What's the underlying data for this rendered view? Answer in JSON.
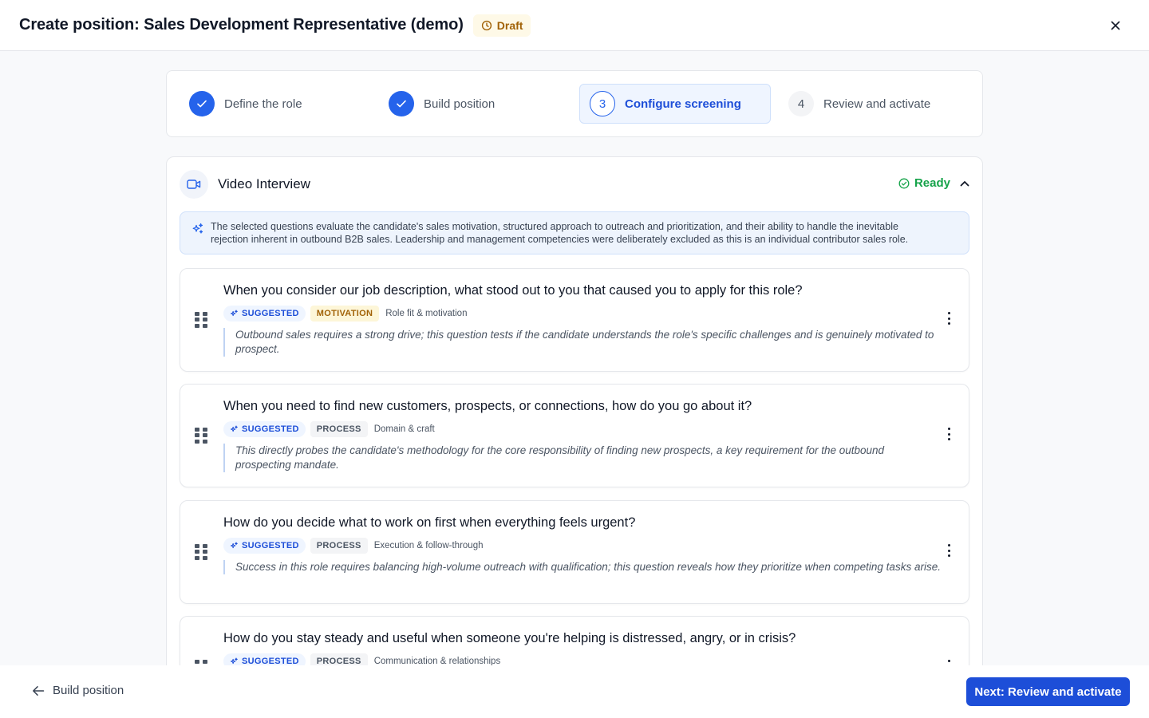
{
  "header": {
    "title": "Create position: Sales Development Representative (demo)",
    "status": "Draft"
  },
  "stepper": {
    "steps": [
      {
        "label": "Define the role",
        "state": "done",
        "number": "1"
      },
      {
        "label": "Build position",
        "state": "done",
        "number": "2"
      },
      {
        "label": "Configure screening",
        "state": "active",
        "number": "3"
      },
      {
        "label": "Review and activate",
        "state": "todo",
        "number": "4"
      }
    ]
  },
  "video_interview": {
    "title": "Video Interview",
    "status": "Ready",
    "summary_line1": "The selected questions evaluate the candidate's sales motivation, structured approach to outreach and prioritization, and their ability to handle the inevitable",
    "summary_line2": "rejection inherent in outbound B2B sales. Leadership and management competencies were deliberately excluded as this is an individual contributor sales role.",
    "questions": [
      {
        "text": "When you consider our job description, what stood out to you that caused you to apply for this role?",
        "suggested": "SUGGESTED",
        "type": "MOTIVATION",
        "category": "Role fit & motivation",
        "reason": "Outbound sales requires a strong drive; this question tests if the candidate understands the role's specific challenges and is genuinely motivated to prospect."
      },
      {
        "text": "When you need to find new customers, prospects, or connections, how do you go about it?",
        "suggested": "SUGGESTED",
        "type": "PROCESS",
        "category": "Domain & craft",
        "reason": "This directly probes the candidate's methodology for the core responsibility of finding new prospects, a key requirement for the outbound prospecting mandate."
      },
      {
        "text": "How do you decide what to work on first when everything feels urgent?",
        "suggested": "SUGGESTED",
        "type": "PROCESS",
        "category": "Execution & follow-through",
        "reason": "Success in this role requires balancing high-volume outreach with qualification; this question reveals how they prioritize when competing tasks arise."
      },
      {
        "text": "How do you stay steady and useful when someone you're helping is distressed, angry, or in crisis?",
        "suggested": "SUGGESTED",
        "type": "PROCESS",
        "category": "Communication & relationships",
        "reason": ""
      }
    ]
  },
  "footer": {
    "back_label": "Build position",
    "next_label": "Next: Review and activate"
  },
  "colors": {
    "primary": "#1d4ed8",
    "ready": "#16a34a",
    "draft_bg": "#fef9e7",
    "draft_text": "#a16207"
  },
  "icons": {
    "draft": "clock-icon",
    "close": "close-icon",
    "step_done": "check-icon",
    "video": "video-camera-icon",
    "ready": "check-circle-icon",
    "collapse": "chevron-up-icon",
    "ai": "sparkles-icon",
    "drag": "drag-handle-icon",
    "menu": "kebab-menu-icon",
    "back": "arrow-left-icon"
  }
}
